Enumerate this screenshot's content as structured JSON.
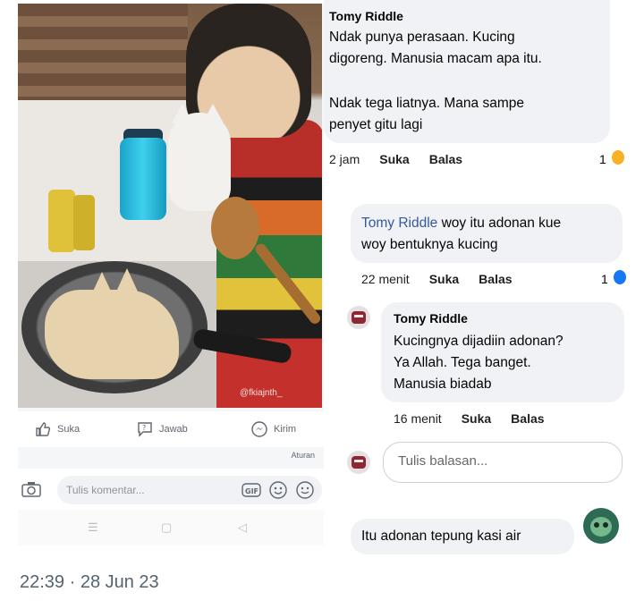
{
  "post": {
    "watermark": "@fkiajnth_",
    "actions": [
      {
        "label": "Suka",
        "icon": "thumbs-up-icon"
      },
      {
        "label": "Jawab",
        "icon": "answer-icon"
      },
      {
        "label": "Kirim",
        "icon": "messenger-icon"
      }
    ],
    "aturan_label": "Aturan",
    "comment_placeholder": "Tulis komentar...",
    "gif_label": "GIF"
  },
  "thread": {
    "comment1": {
      "author": "Tomy Riddle",
      "line1": "Ndak punya perasaan. Kucing",
      "line2": "digoreng. Manusia macam apa itu.",
      "line3": "Ndak tega liatnya. Mana sampe",
      "line4": "penyet gitu lagi",
      "time": "2 jam",
      "like": "Suka",
      "reply": "Balas",
      "reaction_count": "1"
    },
    "comment2": {
      "mention": "Tomy Riddle",
      "line1_rest": " woy itu adonan kue",
      "line2": "woy bentuknya kucing",
      "time": "22 menit",
      "like": "Suka",
      "reply": "Balas",
      "reaction_count": "1"
    },
    "comment3": {
      "author": "Tomy Riddle",
      "line1": "Kucingnya dijadiin adonan?",
      "line2": "Ya Allah. Tega banget.",
      "line3": "Manusia biadab",
      "time": "16 menit",
      "like": "Suka",
      "reply": "Balas"
    },
    "reply_placeholder": "Tulis balasan...",
    "last_comment": "Itu adonan tepung kasi air"
  },
  "footer": {
    "timestamp": "22:39 · 28 Jun 23"
  },
  "colors": {
    "bubble": "#f0f2f5",
    "mention": "#385898",
    "meta_text": "#536471"
  }
}
